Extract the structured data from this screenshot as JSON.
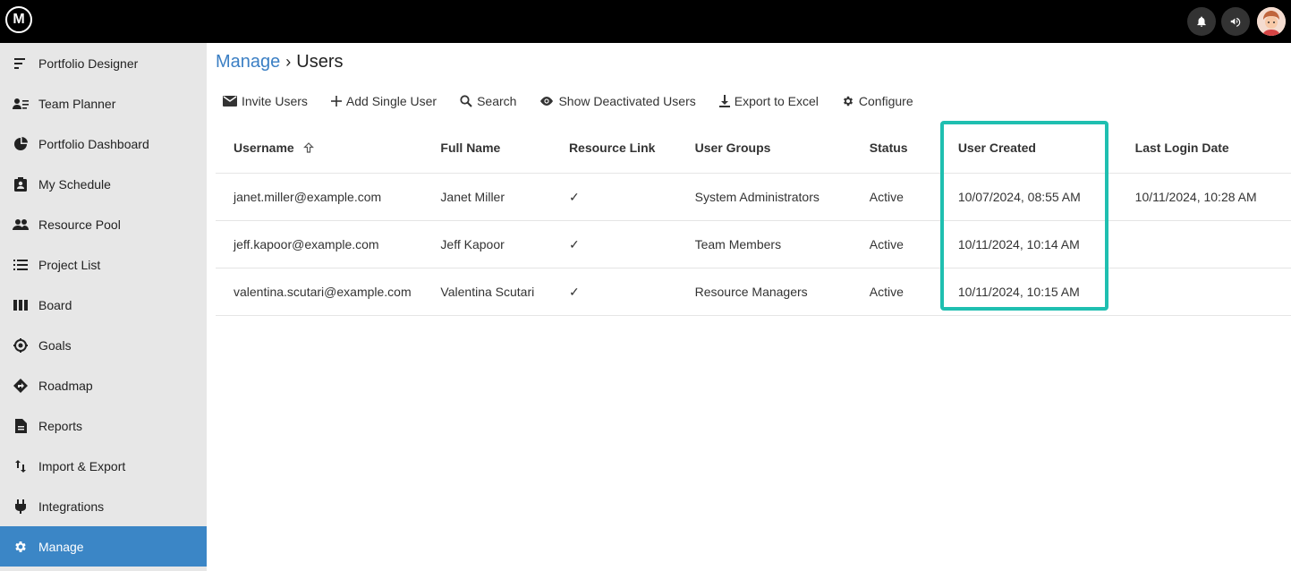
{
  "app": {
    "logo_text": "M"
  },
  "sidebar": {
    "items": [
      {
        "label": "Portfolio Designer",
        "icon": "portfolio-designer-icon"
      },
      {
        "label": "Team Planner",
        "icon": "team-planner-icon"
      },
      {
        "label": "Portfolio Dashboard",
        "icon": "dashboard-icon"
      },
      {
        "label": "My Schedule",
        "icon": "schedule-icon"
      },
      {
        "label": "Resource Pool",
        "icon": "people-icon"
      },
      {
        "label": "Project List",
        "icon": "list-icon"
      },
      {
        "label": "Board",
        "icon": "board-icon"
      },
      {
        "label": "Goals",
        "icon": "target-icon"
      },
      {
        "label": "Roadmap",
        "icon": "roadmap-icon"
      },
      {
        "label": "Reports",
        "icon": "document-icon"
      },
      {
        "label": "Import & Export",
        "icon": "import-export-icon"
      },
      {
        "label": "Integrations",
        "icon": "plug-icon"
      },
      {
        "label": "Manage",
        "icon": "gear-icon"
      }
    ],
    "active": "Manage"
  },
  "breadcrumb": {
    "parent": "Manage",
    "separator": "›",
    "current": "Users"
  },
  "toolbar": {
    "invite": "Invite Users",
    "add_single": "Add Single User",
    "search": "Search",
    "show_deactivated": "Show Deactivated Users",
    "export": "Export to Excel",
    "configure": "Configure"
  },
  "table": {
    "headers": {
      "username": "Username",
      "full_name": "Full Name",
      "resource_link": "Resource Link",
      "user_groups": "User Groups",
      "status": "Status",
      "user_created": "User Created",
      "last_login": "Last Login Date"
    },
    "rows": [
      {
        "username": "janet.miller@example.com",
        "full_name": "Janet Miller",
        "resource_link": "✓",
        "user_groups": "System Administrators",
        "status": "Active",
        "user_created": "10/07/2024, 08:55 AM",
        "last_login": "10/11/2024, 10:28 AM"
      },
      {
        "username": "jeff.kapoor@example.com",
        "full_name": "Jeff Kapoor",
        "resource_link": "✓",
        "user_groups": "Team Members",
        "status": "Active",
        "user_created": "10/11/2024, 10:14 AM",
        "last_login": ""
      },
      {
        "username": "valentina.scutari@example.com",
        "full_name": "Valentina Scutari",
        "resource_link": "✓",
        "user_groups": "Resource Managers",
        "status": "Active",
        "user_created": "10/11/2024, 10:15 AM",
        "last_login": ""
      }
    ]
  },
  "colors": {
    "accent": "#3b86c6",
    "highlight": "#1fbfb0",
    "topbar": "#000000"
  }
}
